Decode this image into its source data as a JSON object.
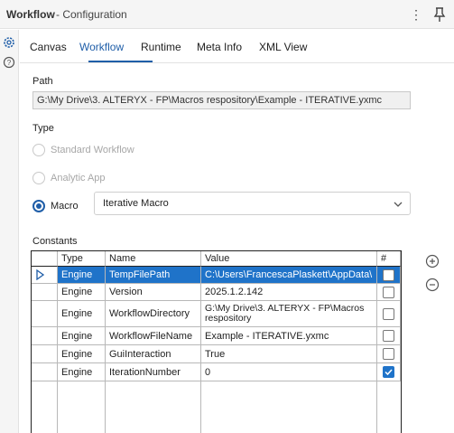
{
  "window": {
    "title": "Workflow",
    "subtitle": "- Configuration"
  },
  "tabs": [
    "Canvas",
    "Workflow",
    "Runtime",
    "Meta Info",
    "XML View"
  ],
  "active_tab": "Workflow",
  "path": {
    "label": "Path",
    "value": "G:\\My Drive\\3. ALTERYX - FP\\Macros respository\\Example - ITERATIVE.yxmc"
  },
  "type": {
    "label": "Type",
    "options": [
      "Standard Workflow",
      "Analytic App",
      "Macro"
    ],
    "selected": "Macro",
    "macro_type": "Iterative Macro"
  },
  "constants": {
    "label": "Constants",
    "headers": [
      "Type",
      "Name",
      "Value",
      "#"
    ],
    "rows": [
      {
        "type": "Engine",
        "name": "TempFilePath",
        "value": "C:\\Users\\FrancescaPlaskett\\AppData\\",
        "checked": false
      },
      {
        "type": "Engine",
        "name": "Version",
        "value": "2025.1.2.142",
        "checked": false
      },
      {
        "type": "Engine",
        "name": "WorkflowDirectory",
        "value": "G:\\My Drive\\3. ALTERYX - FP\\Macros respository",
        "checked": false
      },
      {
        "type": "Engine",
        "name": "WorkflowFileName",
        "value": "Example - ITERATIVE.yxmc",
        "checked": false
      },
      {
        "type": "Engine",
        "name": "GuiInteraction",
        "value": "True",
        "checked": false
      },
      {
        "type": "Engine",
        "name": "IterationNumber",
        "value": "0",
        "checked": true
      }
    ]
  },
  "colors": {
    "accent": "#1f5ea8",
    "selection": "#1f73c9"
  },
  "icons": {
    "kebab": "kebab-icon",
    "pin": "pin-icon",
    "gear": "gear-icon",
    "help": "help-icon",
    "add": "plus-circle-icon",
    "remove": "minus-circle-icon"
  }
}
